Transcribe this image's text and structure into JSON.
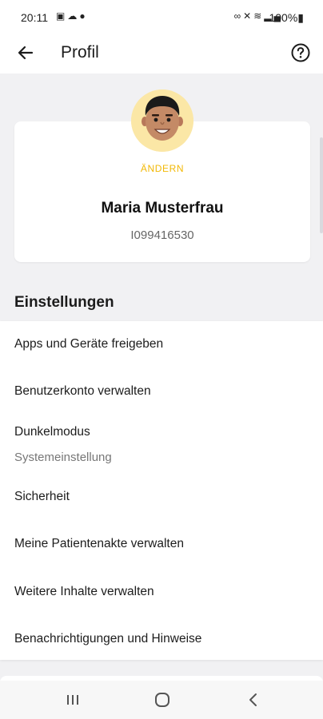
{
  "status_bar": {
    "time": "20:11",
    "left_icons": [
      "gallery-icon",
      "cloud-icon",
      "location-pin-icon"
    ],
    "right_icons": [
      "link-icon",
      "mute-icon",
      "wifi-icon",
      "signal-icon"
    ],
    "battery": "100%"
  },
  "appbar": {
    "title": "Profil",
    "back_icon": "arrow-left-icon",
    "help_icon": "help-circle-icon"
  },
  "profile": {
    "change_label": "ÄNDERN",
    "name": "Maria Musterfrau",
    "id": "I099416530"
  },
  "settings": {
    "title": "Einstellungen",
    "items": [
      {
        "label": "Apps und Geräte freigeben"
      },
      {
        "label": "Benutzerkonto verwalten"
      },
      {
        "label": "Dunkelmodus",
        "sublabel": "Systemeinstellung"
      },
      {
        "label": "Sicherheit"
      },
      {
        "label": "Meine Patientenakte verwalten"
      },
      {
        "label": "Weitere Inhalte verwalten"
      },
      {
        "label": "Benachrichtigungen und Hinweise"
      }
    ]
  },
  "nav": {
    "recent_icon": "recent-apps-icon",
    "home_icon": "home-icon",
    "back_icon": "nav-back-icon"
  },
  "colors": {
    "accent": "#f2b805",
    "background": "#f1f1f3",
    "avatar_bg": "#fbe7a6"
  }
}
